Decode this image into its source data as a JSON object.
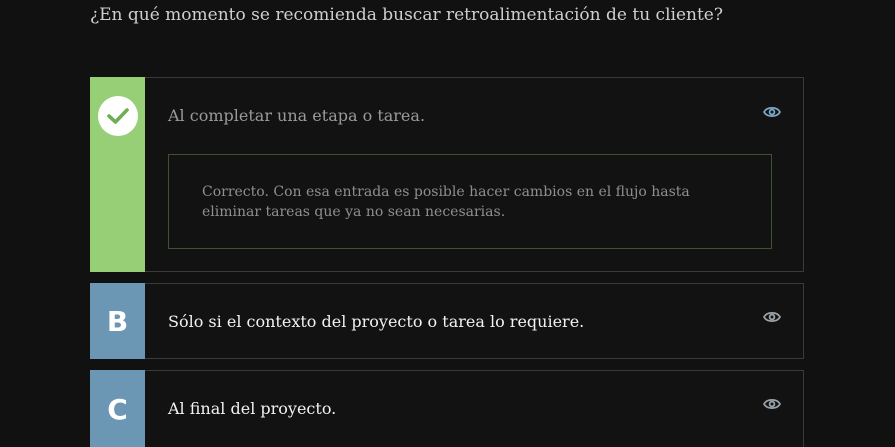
{
  "question": "¿En qué momento se recomienda buscar retroalimentación de tu cliente?",
  "options": [
    {
      "badge": "check-icon",
      "text": "Al completar una etapa o tarea.",
      "feedback": "Correcto. Con esa entrada es posible hacer cambios en el flujo hasta eliminar tareas que ya no sean necesarias.",
      "badge_color": "#97cf76",
      "icon": "eye-icon"
    },
    {
      "badge": "B",
      "text": "Sólo si el contexto del proyecto o tarea lo requiere.",
      "badge_color": "#6b97b5",
      "icon": "eye-icon"
    },
    {
      "badge": "C",
      "text": "Al final del proyecto.",
      "badge_color": "#6b97b5",
      "icon": "eye-icon"
    }
  ],
  "colors": {
    "background": "#111111",
    "correct": "#97cf76",
    "neutral_badge": "#6b97b5",
    "eye_active": "#7fa8c6",
    "eye_inactive": "#9aa3ab"
  }
}
